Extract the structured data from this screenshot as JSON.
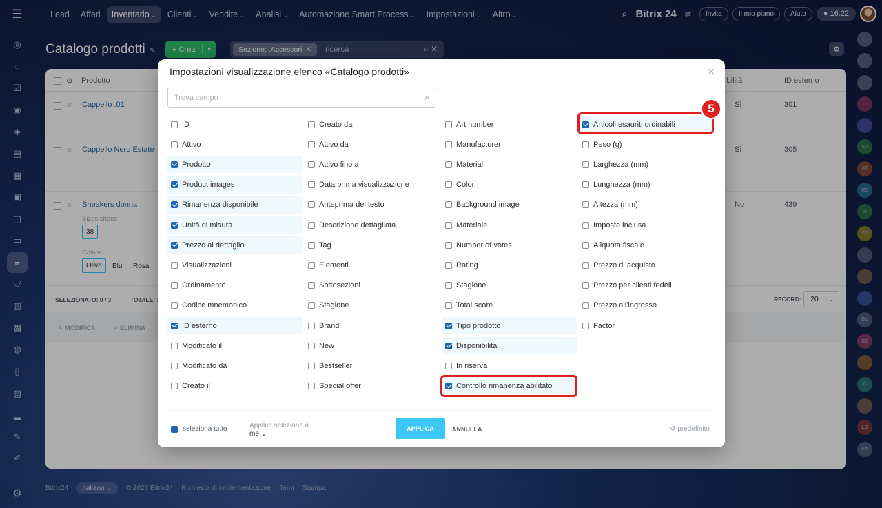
{
  "nav": {
    "items": [
      {
        "label": "Lead",
        "chevron": false,
        "active": false
      },
      {
        "label": "Affari",
        "chevron": false,
        "active": false
      },
      {
        "label": "Inventario",
        "chevron": true,
        "active": true
      },
      {
        "label": "Clienti",
        "chevron": true,
        "active": false
      },
      {
        "label": "Vendite",
        "chevron": true,
        "active": false
      },
      {
        "label": "Analisi",
        "chevron": true,
        "active": false
      },
      {
        "label": "Automazione Smart Process",
        "chevron": true,
        "active": false
      },
      {
        "label": "Impostazioni",
        "chevron": true,
        "active": false
      },
      {
        "label": "Altro",
        "chevron": true,
        "active": false
      }
    ],
    "brand": "Bitrix 24",
    "invite": "Invita",
    "plan": "Il mio piano",
    "help": "Aiuto",
    "time": "16:22"
  },
  "page": {
    "title": "Catalogo prodotti",
    "create_label": "+ Crea",
    "filter_chip": "Sezione: .Accessori",
    "search_placeholder": "ricerca"
  },
  "table": {
    "col_product": "Prodotto",
    "col_availability": "nibilità",
    "col_external_id": "ID esterno",
    "rows": [
      {
        "name": "Cappello .01",
        "availability": "Sì",
        "external_id": "301"
      },
      {
        "name": "Cappello Nero Estate",
        "availability": "Sì",
        "external_id": "305"
      },
      {
        "name": "Sneakers donna",
        "availability": "No",
        "external_id": "439"
      }
    ],
    "variant_size_label": "Sizes shoes",
    "variant_size_value": "38",
    "variant_color_label": "Colore",
    "variant_colors": [
      "Oliva",
      "Blu",
      "Rosa"
    ],
    "selected": "SELEZIONATO: 0 / 3",
    "total": "TOTALE: :",
    "record_label": "RECORD:",
    "record_value": "20",
    "edit": "MODIFICA",
    "delete": "ELIMINA"
  },
  "footer": {
    "brand": "Bitrix24",
    "lang": "Italiano",
    "copyright": "© 2026 Bitrix24",
    "impl": "Richiesta di implementazione",
    "themes": "Temi",
    "print": "Stampa"
  },
  "modal": {
    "title": "Impostazioni visualizzazione elenco «Catalogo prodotti»",
    "search_placeholder": "Trova campo",
    "columns": [
      [
        {
          "label": "ID",
          "checked": false
        },
        {
          "label": "Attivo",
          "checked": false
        },
        {
          "label": "Prodotto",
          "checked": true
        },
        {
          "label": "Product images",
          "checked": true
        },
        {
          "label": "Rimanenza disponibile",
          "checked": true
        },
        {
          "label": "Unità di misura",
          "checked": true
        },
        {
          "label": "Prezzo al dettaglio",
          "checked": true
        },
        {
          "label": "Visualizzazioni",
          "checked": false
        },
        {
          "label": "Ordinamento",
          "checked": false
        },
        {
          "label": "Codice mnemonico",
          "checked": false
        },
        {
          "label": "ID esterno",
          "checked": true
        },
        {
          "label": "Modificato il",
          "checked": false
        },
        {
          "label": "Modificato da",
          "checked": false
        },
        {
          "label": "Creato il",
          "checked": false
        }
      ],
      [
        {
          "label": "Creato da",
          "checked": false
        },
        {
          "label": "Attivo da",
          "checked": false
        },
        {
          "label": "Attivo fino a",
          "checked": false
        },
        {
          "label": "Data prima visualizzazione",
          "checked": false
        },
        {
          "label": "Anteprima del testo",
          "checked": false
        },
        {
          "label": "Descrizione dettagliata",
          "checked": false
        },
        {
          "label": "Tag",
          "checked": false
        },
        {
          "label": "Elementi",
          "checked": false
        },
        {
          "label": "Sottosezioni",
          "checked": false
        },
        {
          "label": "Stagione",
          "checked": false
        },
        {
          "label": "Brand",
          "checked": false
        },
        {
          "label": "New",
          "checked": false
        },
        {
          "label": "Bestseller",
          "checked": false
        },
        {
          "label": "Special offer",
          "checked": false
        }
      ],
      [
        {
          "label": "Art number",
          "checked": false
        },
        {
          "label": "Manufacturer",
          "checked": false
        },
        {
          "label": "Material",
          "checked": false
        },
        {
          "label": "Color",
          "checked": false
        },
        {
          "label": "Background image",
          "checked": false
        },
        {
          "label": "Materiale",
          "checked": false
        },
        {
          "label": "Number of votes",
          "checked": false
        },
        {
          "label": "Rating",
          "checked": false
        },
        {
          "label": "Stagione",
          "checked": false
        },
        {
          "label": "Total score",
          "checked": false
        },
        {
          "label": "Tipo prodotto",
          "checked": true
        },
        {
          "label": "Disponibilità",
          "checked": true
        },
        {
          "label": "In riserva",
          "checked": false
        },
        {
          "label": "Controllo rimanenza abilitato",
          "checked": true
        }
      ],
      [
        {
          "label": "Articoli esauriti ordinabili",
          "checked": true
        },
        {
          "label": "Peso (g)",
          "checked": false
        },
        {
          "label": "Larghezza (mm)",
          "checked": false
        },
        {
          "label": "Lunghezza (mm)",
          "checked": false
        },
        {
          "label": "Altezza (mm)",
          "checked": false
        },
        {
          "label": "Imposta inclusa",
          "checked": false
        },
        {
          "label": "Aliquota fiscale",
          "checked": false
        },
        {
          "label": "Prezzo di acquisto",
          "checked": false
        },
        {
          "label": "Prezzo per clienti fedeli",
          "checked": false
        },
        {
          "label": "Prezzo all'ingrosso",
          "checked": false
        },
        {
          "label": "Factor",
          "checked": false
        }
      ]
    ],
    "badge_number": "5",
    "select_all": "seleziona tutto",
    "apply_to_label": "Applica selezione a",
    "apply_to_value": "me",
    "apply": "APPLICA",
    "cancel": "ANNULLA",
    "default": "predefinito",
    "highlight_color": "#e0201d"
  },
  "right_rail": [
    "",
    "",
    "",
    "",
    "",
    "SD",
    "ST",
    "RS",
    "TI",
    "SD",
    "",
    "",
    "",
    "DU",
    "SS",
    "",
    "C",
    "",
    "LD",
    "FA"
  ]
}
